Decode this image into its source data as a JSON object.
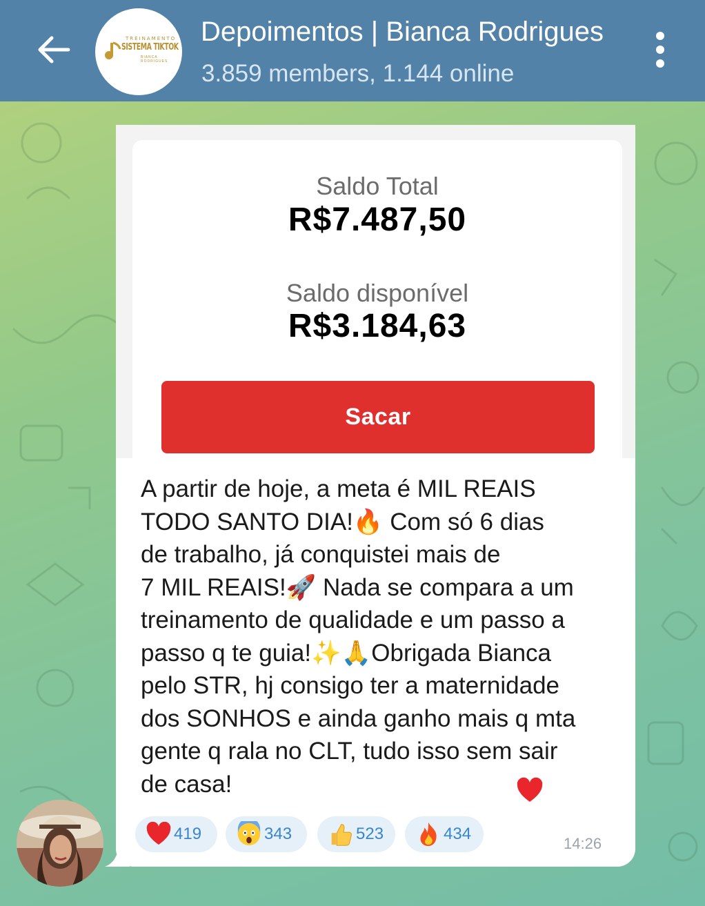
{
  "header": {
    "title": "Depoimentos | Bianca Rodrigues",
    "subtitle": "3.859 members, 1.144 online",
    "back_icon": "arrow-left-icon",
    "menu_icon": "more-vertical-icon",
    "logo": {
      "top_text": "TREINAMENTO",
      "main_text": "SISTEMA TIKTOK",
      "bottom_text": "BIANCA RODRIGUES"
    },
    "background_color": "#5382a8"
  },
  "wallet": {
    "total_label": "Saldo Total",
    "total_value": "R$7.487,50",
    "available_label": "Saldo disponível",
    "available_value": "R$3.184,63",
    "withdraw_label": "Sacar",
    "button_color": "#e0302e"
  },
  "message": {
    "text": "A partir de hoje, a meta é MIL REAIS\nTODO SANTO DIA!🔥 Com só 6 dias\nde trabalho, já conquistei mais de\n7 MIL REAIS!🚀 Nada se compara a um\ntreinamento de qualidade e um passo a\npasso q te guia!✨🙏Obrigada Bianca\npelo STR, hj consigo ter a maternidade\ndos SONHOS e ainda ganho mais q mta\ngente q rala no CLT, tudo isso sem sair\nde casa!",
    "trailing_emoji": "heart-icon",
    "time": "14:26"
  },
  "reactions": [
    {
      "emoji": "heart-icon",
      "count": "419"
    },
    {
      "emoji": "screaming-face-icon",
      "count": "343"
    },
    {
      "emoji": "thumbs-up-icon",
      "count": "523"
    },
    {
      "emoji": "fire-icon",
      "count": "434"
    }
  ],
  "sender": {
    "avatar": "sender-avatar-photo"
  }
}
